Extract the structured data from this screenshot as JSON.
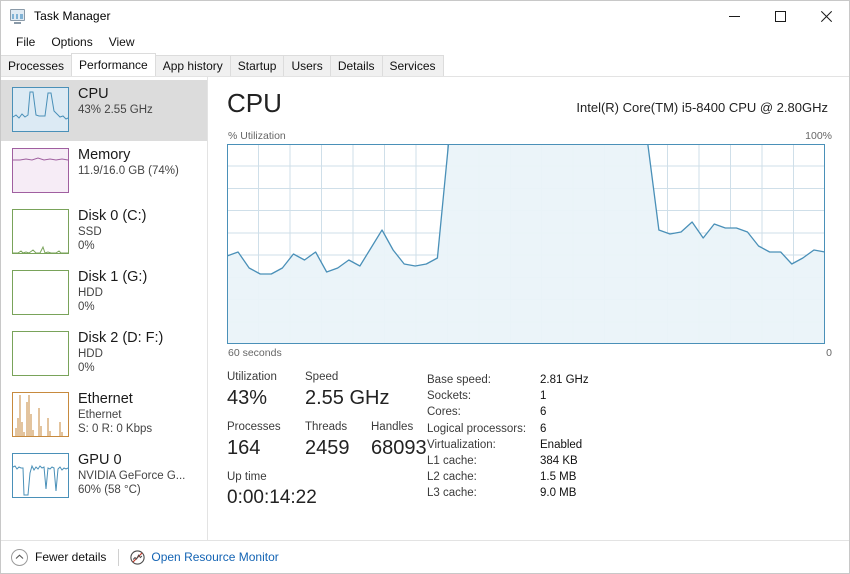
{
  "window": {
    "title": "Task Manager",
    "icon": "task-manager-icon",
    "controls": {
      "minimize": "minimize-icon",
      "maximize": "maximize-icon",
      "close": "close-icon"
    }
  },
  "menu": {
    "items": [
      "File",
      "Options",
      "View"
    ]
  },
  "tabs": {
    "items": [
      "Processes",
      "Performance",
      "App history",
      "Startup",
      "Users",
      "Details",
      "Services"
    ],
    "active": "Performance"
  },
  "sidebar": {
    "items": [
      {
        "title": "CPU",
        "sub1": "43% 2.55 GHz",
        "sub2": "",
        "selected": true,
        "color": "#4a90b8",
        "fill": "#dceaf4"
      },
      {
        "title": "Memory",
        "sub1": "11.9/16.0 GB (74%)",
        "sub2": "",
        "selected": false,
        "color": "#a05fa0",
        "fill": "#f6ecf6"
      },
      {
        "title": "Disk 0 (C:)",
        "sub1": "SSD",
        "sub2": "0%",
        "selected": false,
        "color": "#79a35a",
        "fill": "#eef5e8"
      },
      {
        "title": "Disk 1 (G:)",
        "sub1": "HDD",
        "sub2": "0%",
        "selected": false,
        "color": "#79a35a",
        "fill": "#eef5e8"
      },
      {
        "title": "Disk 2 (D: F:)",
        "sub1": "HDD",
        "sub2": "0%",
        "selected": false,
        "color": "#79a35a",
        "fill": "#eef5e8"
      },
      {
        "title": "Ethernet",
        "sub1": "Ethernet",
        "sub2": "S: 0 R: 0 Kbps",
        "selected": false,
        "color": "#c78a3e",
        "fill": "#f8efe2"
      },
      {
        "title": "GPU 0",
        "sub1": "NVIDIA GeForce G...",
        "sub2": "60%  (58 °C)",
        "selected": false,
        "color": "#4a90b8",
        "fill": "#dceaf4"
      }
    ]
  },
  "main": {
    "title": "CPU",
    "subtitle": "Intel(R) Core(TM) i5-8400 CPU @ 2.80GHz",
    "axis_y_label": "% Utilization",
    "axis_y_max": "100%",
    "axis_x_left": "60 seconds",
    "axis_x_right": "0",
    "stats": {
      "utilization_label": "Utilization",
      "utilization_value": "43%",
      "speed_label": "Speed",
      "speed_value": "2.55 GHz",
      "processes_label": "Processes",
      "processes_value": "164",
      "threads_label": "Threads",
      "threads_value": "2459",
      "handles_label": "Handles",
      "handles_value": "68093",
      "uptime_label": "Up time",
      "uptime_value": "0:00:14:22"
    },
    "details": [
      {
        "key": "Base speed:",
        "value": "2.81 GHz"
      },
      {
        "key": "Sockets:",
        "value": "1"
      },
      {
        "key": "Cores:",
        "value": "6"
      },
      {
        "key": "Logical processors:",
        "value": "6"
      },
      {
        "key": "Virtualization:",
        "value": "Enabled"
      },
      {
        "key": "L1 cache:",
        "value": "384 KB"
      },
      {
        "key": "L2 cache:",
        "value": "1.5 MB"
      },
      {
        "key": "L3 cache:",
        "value": "9.0 MB"
      }
    ]
  },
  "footer": {
    "fewer_details": "Fewer details",
    "open_resource_monitor": "Open Resource Monitor"
  },
  "colors": {
    "accent_line": "#4a90b8",
    "accent_fill": "#eaf3f9",
    "grid": "#cfdfe9",
    "link": "#1464b4",
    "selection": "#dcdcdc"
  },
  "chart_data": {
    "type": "area",
    "title": "CPU % Utilization over 60 seconds",
    "xlabel": "60 seconds",
    "ylabel": "% Utilization",
    "ylim": [
      0,
      100
    ],
    "xlim": [
      0,
      60
    ],
    "grid": true,
    "gridlines_x": 19,
    "gridlines_y": 9,
    "series": [
      {
        "name": "CPU Utilization",
        "color": "#4a90b8",
        "fill": "#eaf3f9",
        "values": [
          44,
          46,
          38,
          35,
          35,
          38,
          45,
          42,
          46,
          36,
          38,
          42,
          39,
          48,
          57,
          47,
          40,
          39,
          40,
          43,
          100,
          100,
          100,
          100,
          100,
          100,
          100,
          100,
          100,
          100,
          100,
          100,
          100,
          100,
          100,
          100,
          100,
          100,
          100,
          57,
          55,
          56,
          61,
          53,
          60,
          58,
          58,
          56,
          49,
          46,
          46,
          40,
          43,
          47,
          46
        ]
      }
    ]
  }
}
